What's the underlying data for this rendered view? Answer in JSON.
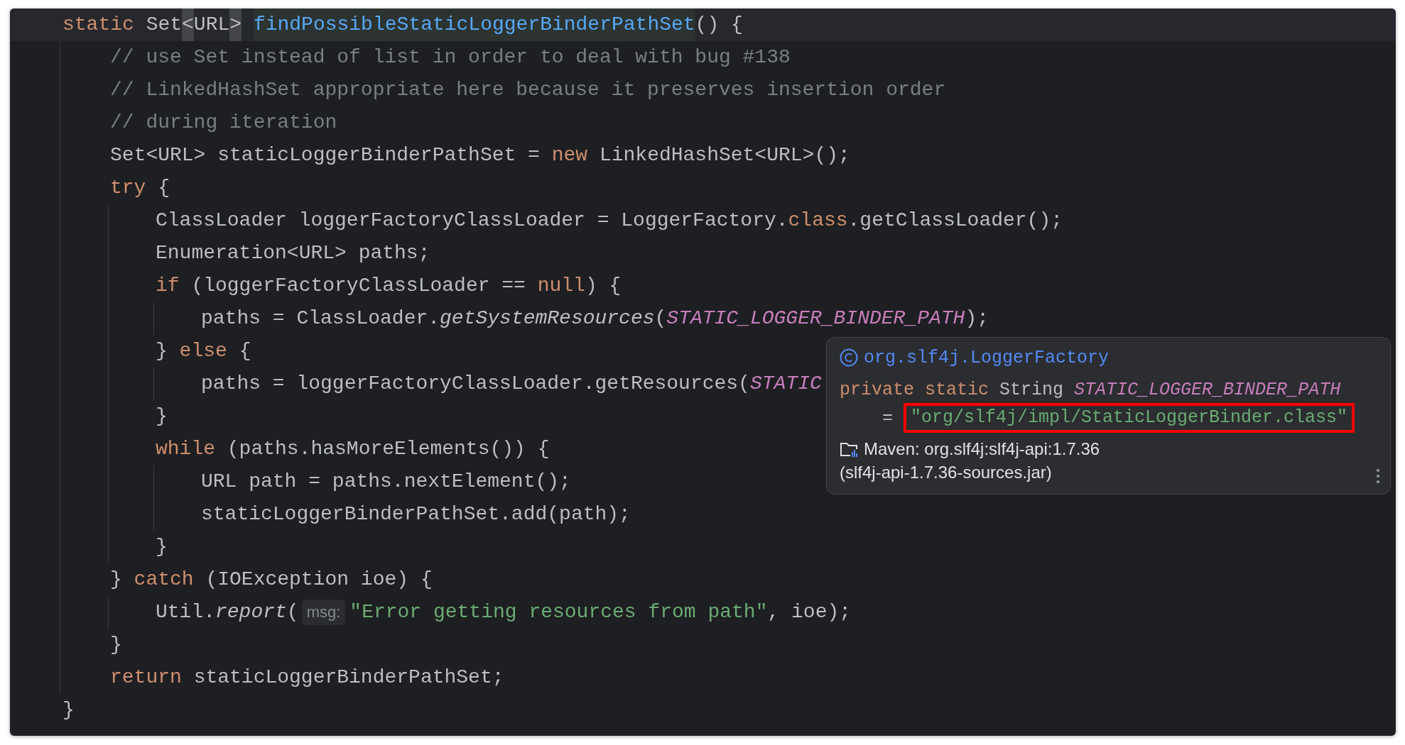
{
  "code": {
    "signature": [
      {
        "kind": "keyword",
        "text": "static"
      },
      {
        "kind": "plain",
        "text": " Set"
      },
      {
        "kind": "bracket",
        "text": "<"
      },
      {
        "kind": "plain",
        "text": "URL"
      },
      {
        "kind": "bracket",
        "text": ">"
      },
      {
        "kind": "declaration",
        "text": "findPossibleStaticLoggerBinderPathSet"
      },
      {
        "kind": "plain",
        "text": "() {"
      }
    ],
    "body": [
      {
        "tokens": [
          {
            "kind": "comment",
            "text": "// use Set instead of list in order to deal with bug #138"
          }
        ]
      },
      {
        "tokens": [
          {
            "kind": "comment",
            "text": "// LinkedHashSet appropriate here because it preserves insertion order"
          }
        ]
      },
      {
        "tokens": [
          {
            "kind": "comment",
            "text": "// during iteration"
          }
        ]
      },
      {
        "tokens": [
          {
            "kind": "plain",
            "text": "Set<URL> staticLoggerBinderPathSet = "
          },
          {
            "kind": "keyword",
            "text": "new"
          },
          {
            "kind": "plain",
            "text": " LinkedHashSet<URL>();"
          }
        ]
      },
      {
        "tokens": [
          {
            "kind": "keyword",
            "text": "try"
          },
          {
            "kind": "plain",
            "text": " {"
          }
        ],
        "children": [
          {
            "tokens": [
              {
                "kind": "plain",
                "text": "ClassLoader loggerFactoryClassLoader = LoggerFactory."
              },
              {
                "kind": "keyword",
                "text": "class"
              },
              {
                "kind": "plain",
                "text": ".getClassLoader();"
              }
            ]
          },
          {
            "tokens": [
              {
                "kind": "plain",
                "text": "Enumeration<URL> paths;"
              }
            ]
          },
          {
            "tokens": [
              {
                "kind": "keyword",
                "text": "if"
              },
              {
                "kind": "plain",
                "text": " (loggerFactoryClassLoader == "
              },
              {
                "kind": "keyword",
                "text": "null"
              },
              {
                "kind": "plain",
                "text": ") {"
              }
            ],
            "children": [
              {
                "tokens": [
                  {
                    "kind": "plain",
                    "text": "paths = ClassLoader."
                  },
                  {
                    "kind": "italic",
                    "text": "getSystemResources"
                  },
                  {
                    "kind": "plain",
                    "text": "("
                  },
                  {
                    "kind": "constant",
                    "text": "STATIC_LOGGER_BINDER_PATH"
                  },
                  {
                    "kind": "plain",
                    "text": ");"
                  }
                ]
              }
            ]
          },
          {
            "tokens": [
              {
                "kind": "plain",
                "text": "} "
              },
              {
                "kind": "keyword",
                "text": "else"
              },
              {
                "kind": "plain",
                "text": " {"
              }
            ],
            "children": [
              {
                "tokens": [
                  {
                    "kind": "plain",
                    "text": "paths = loggerFactoryClassLoader.getResources("
                  },
                  {
                    "kind": "constant",
                    "text": "STATIC"
                  }
                ]
              }
            ]
          },
          {
            "tokens": [
              {
                "kind": "plain",
                "text": "}"
              }
            ]
          },
          {
            "tokens": [
              {
                "kind": "keyword",
                "text": "while"
              },
              {
                "kind": "plain",
                "text": " (paths.hasMoreElements()) {"
              }
            ],
            "children": [
              {
                "tokens": [
                  {
                    "kind": "plain",
                    "text": "URL path = paths.nextElement();"
                  }
                ]
              },
              {
                "tokens": [
                  {
                    "kind": "plain",
                    "text": "staticLoggerBinderPathSet.add(path);"
                  }
                ]
              }
            ]
          },
          {
            "tokens": [
              {
                "kind": "plain",
                "text": "}"
              }
            ]
          }
        ]
      },
      {
        "tokens": [
          {
            "kind": "plain",
            "text": "} "
          },
          {
            "kind": "keyword",
            "text": "catch"
          },
          {
            "kind": "plain",
            "text": " (IOException ioe) {"
          }
        ],
        "children": [
          {
            "tokens": [
              {
                "kind": "plain",
                "text": "Util."
              },
              {
                "kind": "italic",
                "text": "report"
              },
              {
                "kind": "plain",
                "text": "("
              },
              {
                "kind": "hint",
                "text": "msg:"
              },
              {
                "kind": "string",
                "text": "\"Error getting resources from path\""
              },
              {
                "kind": "plain",
                "text": ", ioe);"
              }
            ]
          }
        ]
      },
      {
        "tokens": [
          {
            "kind": "plain",
            "text": "}"
          }
        ]
      },
      {
        "tokens": [
          {
            "kind": "keyword",
            "text": "return"
          },
          {
            "kind": "plain",
            "text": " staticLoggerBinderPathSet;"
          }
        ]
      }
    ],
    "closing": [
      {
        "kind": "plain",
        "text": "}"
      }
    ]
  },
  "tooltip": {
    "title": "org.slf4j.LoggerFactory",
    "declaration": [
      [
        {
          "kind": "keyword",
          "text": "private static",
          "boxed": false
        },
        {
          "kind": "plain",
          "text": " String ",
          "boxed": false
        },
        {
          "kind": "constant",
          "text": "STATIC_LOGGER_BINDER_PATH",
          "boxed": false
        }
      ],
      [
        {
          "kind": "plain",
          "text": "= ",
          "boxed": false
        },
        {
          "kind": "string",
          "text": "\"org/slf4j/impl/StaticLoggerBinder.class\"",
          "boxed": true
        }
      ]
    ],
    "library": "Maven: org.slf4j:slf4j-api:1.7.36",
    "archive": "(slf4j-api-1.7.36-sources.jar)"
  }
}
